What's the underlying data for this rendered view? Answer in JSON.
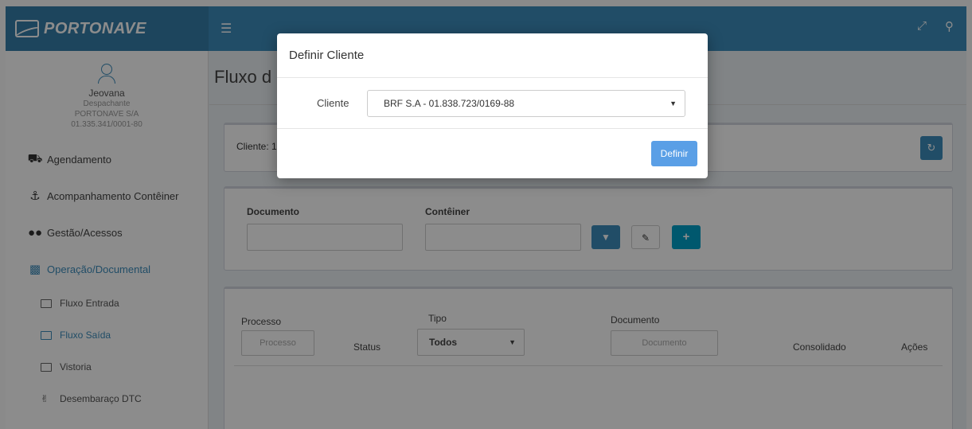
{
  "brand": {
    "name": "PORTONAVE"
  },
  "topbar": {
    "menu_icon": "hamburger-icon",
    "expand_icon": "expand-icon",
    "user_icon": "user-icon"
  },
  "user": {
    "name": "Jeovana",
    "role": "Despachante",
    "company": "PORTONAVE S/A",
    "cnpj": "01.335.341/0001-80"
  },
  "sidebar": {
    "items": [
      {
        "label": "Agendamento",
        "icon": "truck-icon"
      },
      {
        "label": "Acompanhamento Contêiner",
        "icon": "anchor-icon"
      },
      {
        "label": "Gestão/Acessos",
        "icon": "users-icon"
      },
      {
        "label": "Operação/Documental",
        "icon": "bar-chart-icon",
        "active": true
      }
    ],
    "subitems": [
      {
        "label": "Fluxo Entrada"
      },
      {
        "label": "Fluxo Saída",
        "active": true
      },
      {
        "label": "Vistoria"
      },
      {
        "label": "Desembaraço DTC"
      }
    ]
  },
  "page": {
    "title": "Fluxo d"
  },
  "client_box": {
    "label": "Cliente: 1",
    "refresh_icon": "refresh-icon"
  },
  "filter": {
    "documento_label": "Documento",
    "container_label": "Contêiner",
    "filter_icon": "filter-icon",
    "eraser_icon": "eraser-icon",
    "add_label": "+"
  },
  "table": {
    "processo_label": "Processo",
    "processo_placeholder": "Processo",
    "status_header": "Status",
    "tipo_label": "Tipo",
    "tipo_value": "Todos",
    "documento_label": "Documento",
    "documento_placeholder": "Documento",
    "consolidado_header": "Consolidado",
    "acoes_header": "Ações"
  },
  "modal": {
    "title": "Definir Cliente",
    "field_label": "Cliente",
    "selected_client": "BRF S.A - 01.838.723/0169-88",
    "submit_label": "Definir"
  },
  "colors": {
    "primary": "#3c8dbc",
    "header_dark": "#367fa9",
    "accent": "#00a0c8",
    "modal_button": "#5a9fe6"
  }
}
